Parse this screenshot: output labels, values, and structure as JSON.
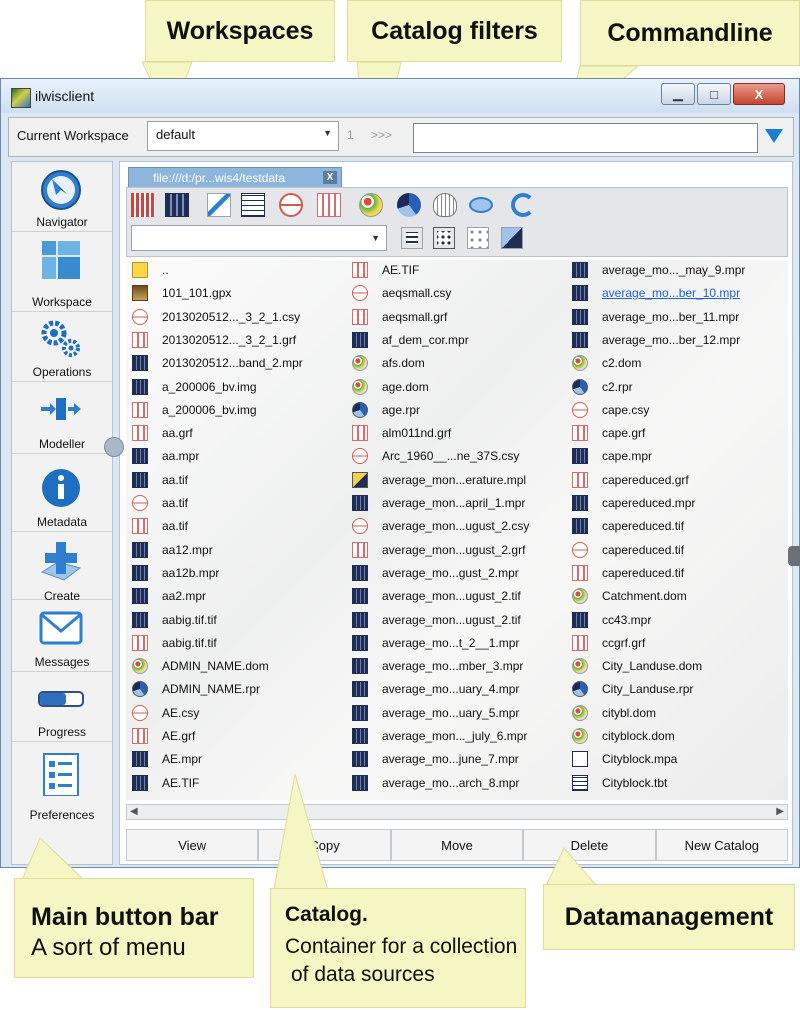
{
  "annotations": {
    "workspaces": "Workspaces",
    "catalog_filters": "Catalog filters",
    "commandline": "Commandline",
    "main_button_bar_title": "Main button bar",
    "main_button_bar_sub": "A sort of menu",
    "catalog_title": "Catalog.",
    "catalog_line1": "Container for a collection",
    "catalog_line2": "of data sources",
    "datamanagement": "Datamanagement"
  },
  "window": {
    "title": "ilwisclient",
    "min_glyph": "▁",
    "max_glyph": "□",
    "close_glyph": "X"
  },
  "workspace_bar": {
    "label": "Current Workspace",
    "selected": "default",
    "command_number": "1",
    "command_prompt": ">>>",
    "command_value": ""
  },
  "sidebar": [
    {
      "label": "Navigator",
      "icon": "compass-icon"
    },
    {
      "label": "Workspace",
      "icon": "workspace-grid-icon"
    },
    {
      "label": "Operations",
      "icon": "gears-icon"
    },
    {
      "label": "Modeller",
      "icon": "modeller-icon"
    },
    {
      "label": "Metadata",
      "icon": "info-icon"
    },
    {
      "label": "Create",
      "icon": "create-plus-icon"
    },
    {
      "label": "Messages",
      "icon": "envelope-icon"
    },
    {
      "label": "Progress",
      "icon": "progress-bar-icon"
    },
    {
      "label": "Preferences",
      "icon": "checklist-icon"
    }
  ],
  "catalog_tab": {
    "label": "file:///d:/pr...wis4/testdata",
    "close_glyph": "X"
  },
  "filter_buttons": [
    "all-types-filter-icon",
    "raster-filter-icon",
    "feature-filter-icon",
    "table-filter-icon",
    "coordinate-system-filter-icon",
    "georeference-filter-icon",
    "domain-filter-icon",
    "representation-filter-icon",
    "projection-filter-icon",
    "ellipsoid-filter-icon",
    "refresh-icon"
  ],
  "view_buttons": [
    "list-view-icon",
    "grid-view-icon",
    "thumbnail-view-icon",
    "map-view-icon"
  ],
  "filter_text": "",
  "catalog": {
    "columns": [
      [
        {
          "name": "..",
          "type": "folder"
        },
        {
          "name": "101_101.gpx",
          "type": "gpx"
        },
        {
          "name": "2013020512..._3_2_1.csy",
          "type": "csy"
        },
        {
          "name": "2013020512..._3_2_1.grf",
          "type": "grf"
        },
        {
          "name": "2013020512...band_2.mpr",
          "type": "mpr"
        },
        {
          "name": "a_200006_bv.img",
          "type": "mpr"
        },
        {
          "name": "a_200006_bv.img",
          "type": "grf"
        },
        {
          "name": "aa.grf",
          "type": "grf"
        },
        {
          "name": "aa.mpr",
          "type": "mpr"
        },
        {
          "name": "aa.tif",
          "type": "mpr"
        },
        {
          "name": "aa.tif",
          "type": "csy"
        },
        {
          "name": "aa.tif",
          "type": "grf"
        },
        {
          "name": "aa12.mpr",
          "type": "mpr"
        },
        {
          "name": "aa12b.mpr",
          "type": "mpr"
        },
        {
          "name": "aa2.mpr",
          "type": "mpr"
        },
        {
          "name": "aabig.tif.tif",
          "type": "mpr"
        },
        {
          "name": "aabig.tif.tif",
          "type": "grf"
        },
        {
          "name": "ADMIN_NAME.dom",
          "type": "dom"
        },
        {
          "name": "ADMIN_NAME.rpr",
          "type": "rpr"
        },
        {
          "name": "AE.csy",
          "type": "csy"
        },
        {
          "name": "AE.grf",
          "type": "grf"
        },
        {
          "name": "AE.mpr",
          "type": "mpr"
        },
        {
          "name": "AE.TIF",
          "type": "mpr"
        }
      ],
      [
        {
          "name": "AE.TIF",
          "type": "grf"
        },
        {
          "name": "aeqsmall.csy",
          "type": "csy"
        },
        {
          "name": "aeqsmall.grf",
          "type": "grf"
        },
        {
          "name": "af_dem_cor.mpr",
          "type": "mpr"
        },
        {
          "name": "afs.dom",
          "type": "dom"
        },
        {
          "name": "age.dom",
          "type": "dom"
        },
        {
          "name": "age.rpr",
          "type": "rpr"
        },
        {
          "name": "alm011nd.grf",
          "type": "grf"
        },
        {
          "name": "Arc_1960__...ne_37S.csy",
          "type": "csy"
        },
        {
          "name": "average_mon...erature.mpl",
          "type": "mpl"
        },
        {
          "name": "average_mon...april_1.mpr",
          "type": "mpr"
        },
        {
          "name": "average_mon...ugust_2.csy",
          "type": "csy"
        },
        {
          "name": "average_mon...ugust_2.grf",
          "type": "grf"
        },
        {
          "name": "average_mo...gust_2.mpr",
          "type": "mpr"
        },
        {
          "name": "average_mon...ugust_2.tif",
          "type": "mpr"
        },
        {
          "name": "average_mon...ugust_2.tif",
          "type": "mpr"
        },
        {
          "name": "average_mo...t_2__1.mpr",
          "type": "mpr"
        },
        {
          "name": "average_mo...mber_3.mpr",
          "type": "mpr"
        },
        {
          "name": "average_mo...uary_4.mpr",
          "type": "mpr"
        },
        {
          "name": "average_mo...uary_5.mpr",
          "type": "mpr"
        },
        {
          "name": "average_mon..._july_6.mpr",
          "type": "mpr"
        },
        {
          "name": "average_mo...june_7.mpr",
          "type": "mpr"
        },
        {
          "name": "average_mo...arch_8.mpr",
          "type": "mpr"
        }
      ],
      [
        {
          "name": "average_mo..._may_9.mpr",
          "type": "mpr"
        },
        {
          "name": "average_mo...ber_10.mpr",
          "type": "mpr",
          "selected": true
        },
        {
          "name": "average_mo...ber_11.mpr",
          "type": "mpr"
        },
        {
          "name": "average_mo...ber_12.mpr",
          "type": "mpr"
        },
        {
          "name": "c2.dom",
          "type": "dom"
        },
        {
          "name": "c2.rpr",
          "type": "rpr"
        },
        {
          "name": "cape.csy",
          "type": "csy"
        },
        {
          "name": "cape.grf",
          "type": "grf"
        },
        {
          "name": "cape.mpr",
          "type": "mpr"
        },
        {
          "name": "capereduced.grf",
          "type": "grf"
        },
        {
          "name": "capereduced.mpr",
          "type": "mpr"
        },
        {
          "name": "capereduced.tif",
          "type": "mpr"
        },
        {
          "name": "capereduced.tif",
          "type": "csy"
        },
        {
          "name": "capereduced.tif",
          "type": "grf"
        },
        {
          "name": "Catchment.dom",
          "type": "dom"
        },
        {
          "name": "cc43.mpr",
          "type": "mpr"
        },
        {
          "name": "ccgrf.grf",
          "type": "grf"
        },
        {
          "name": "City_Landuse.dom",
          "type": "dom"
        },
        {
          "name": "City_Landuse.rpr",
          "type": "rpr"
        },
        {
          "name": "citybl.dom",
          "type": "dom"
        },
        {
          "name": "cityblock.dom",
          "type": "dom"
        },
        {
          "name": "Cityblock.mpa",
          "type": "mpa"
        },
        {
          "name": "Cityblock.tbt",
          "type": "tbt"
        }
      ]
    ]
  },
  "actions": [
    "View",
    "Copy",
    "Move",
    "Delete",
    "New Catalog"
  ],
  "scroll": {
    "left_glyph": "◀",
    "right_glyph": "▶"
  }
}
